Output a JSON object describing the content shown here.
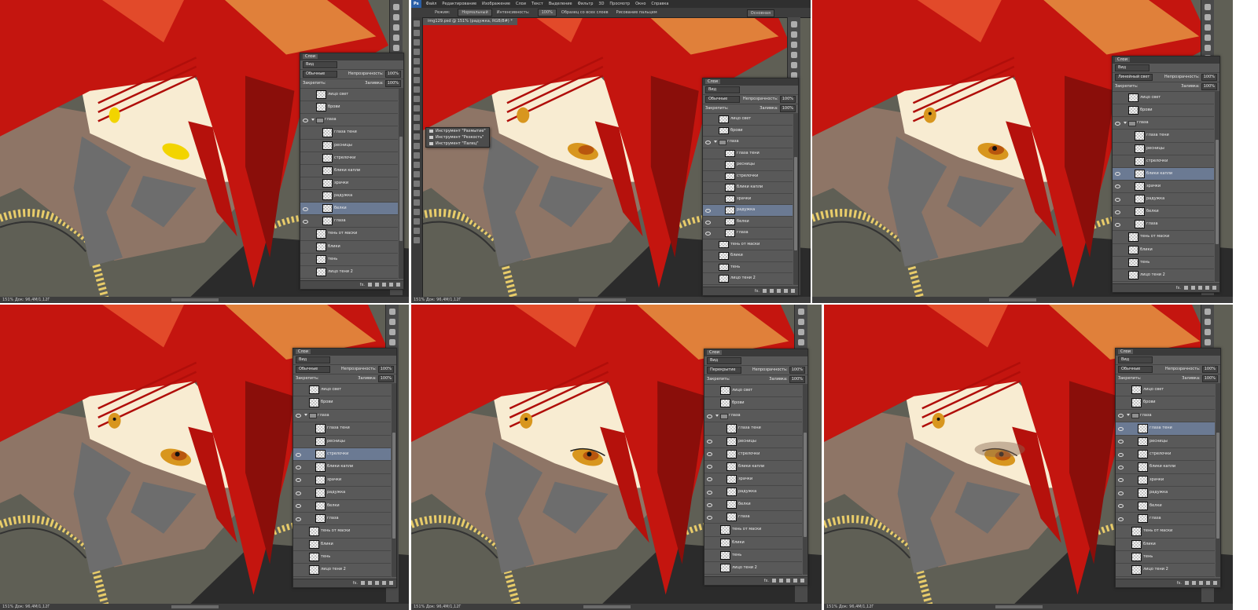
{
  "photoshop": {
    "logo": "Ps",
    "menu": [
      "Файл",
      "Редактирование",
      "Изображение",
      "Слои",
      "Текст",
      "Выделение",
      "Фильтр",
      "3D",
      "Просмотр",
      "Окно",
      "Справка"
    ],
    "options": {
      "mode_label": "Режим:",
      "mode_value": "Нормальный",
      "intensity_label": "Интенсивность:",
      "intensity_value": "100%",
      "sample_all": "Образец со всех слоев",
      "finger": "Рисование пальцем",
      "workspace": "Основная"
    },
    "tab": "img129.psd @ 151% (радужка, RGB/8#) *",
    "tool_flyout": [
      "Инструмент \"Размытие\"",
      "Инструмент \"Резкость\"",
      "Инструмент \"Палец\""
    ]
  },
  "layers_panel": {
    "title": "Слои",
    "filter": "Вид",
    "opacity_label": "Непрозрачность:",
    "opacity_value": "100%",
    "lock_label": "Закрепить:",
    "fill_label": "Заливка:",
    "fill_value": "100%",
    "footer_icon": "fx."
  },
  "panels": [
    {
      "id": "p1",
      "blend": "Обычные",
      "status": "151%  Док: 96,4M/1,12Г",
      "layers": [
        {
          "name": "лицо свет",
          "indent": 0,
          "kind": "layer",
          "visible": false,
          "active": false
        },
        {
          "name": "брови",
          "indent": 0,
          "kind": "layer",
          "visible": false,
          "active": false
        },
        {
          "name": "глаза",
          "indent": 0,
          "kind": "group",
          "visible": true,
          "active": false
        },
        {
          "name": "глаза тени",
          "indent": 1,
          "kind": "layer",
          "visible": false,
          "active": false
        },
        {
          "name": "ресницы",
          "indent": 1,
          "kind": "layer",
          "visible": false,
          "active": false
        },
        {
          "name": "стрелочки",
          "indent": 1,
          "kind": "layer",
          "visible": false,
          "active": false
        },
        {
          "name": "блики капли",
          "indent": 1,
          "kind": "layer",
          "visible": false,
          "active": false
        },
        {
          "name": "зрачки",
          "indent": 1,
          "kind": "layer",
          "visible": false,
          "active": false
        },
        {
          "name": "радужка",
          "indent": 1,
          "kind": "layer",
          "visible": false,
          "active": false
        },
        {
          "name": "белки",
          "indent": 1,
          "kind": "layer",
          "visible": true,
          "active": true
        },
        {
          "name": "глаза",
          "indent": 1,
          "kind": "layer",
          "visible": true,
          "active": false
        },
        {
          "name": "тень от маски",
          "indent": 0,
          "kind": "layer",
          "visible": false,
          "active": false
        },
        {
          "name": "блики",
          "indent": 0,
          "kind": "layer",
          "visible": false,
          "active": false
        },
        {
          "name": "тень",
          "indent": 0,
          "kind": "layer",
          "visible": false,
          "active": false
        },
        {
          "name": "лицо тени 2",
          "indent": 0,
          "kind": "layer",
          "visible": false,
          "active": false
        }
      ]
    },
    {
      "id": "p2",
      "blend": "Обычные",
      "status": "151%  Док: 96,4M/1,12Г",
      "layers": [
        {
          "name": "лицо свет",
          "indent": 0,
          "kind": "layer",
          "visible": false,
          "active": false
        },
        {
          "name": "брови",
          "indent": 0,
          "kind": "layer",
          "visible": false,
          "active": false
        },
        {
          "name": "глаза",
          "indent": 0,
          "kind": "group",
          "visible": true,
          "active": false
        },
        {
          "name": "глаза тени",
          "indent": 1,
          "kind": "layer",
          "visible": false,
          "active": false
        },
        {
          "name": "ресницы",
          "indent": 1,
          "kind": "layer",
          "visible": false,
          "active": false
        },
        {
          "name": "стрелочки",
          "indent": 1,
          "kind": "layer",
          "visible": false,
          "active": false
        },
        {
          "name": "блики капли",
          "indent": 1,
          "kind": "layer",
          "visible": false,
          "active": false
        },
        {
          "name": "зрачки",
          "indent": 1,
          "kind": "layer",
          "visible": false,
          "active": false
        },
        {
          "name": "радужка",
          "indent": 1,
          "kind": "layer",
          "visible": true,
          "active": true
        },
        {
          "name": "белки",
          "indent": 1,
          "kind": "layer",
          "visible": true,
          "active": false
        },
        {
          "name": "глаза",
          "indent": 1,
          "kind": "layer",
          "visible": true,
          "active": false
        },
        {
          "name": "тень от маски",
          "indent": 0,
          "kind": "layer",
          "visible": false,
          "active": false
        },
        {
          "name": "блики",
          "indent": 0,
          "kind": "layer",
          "visible": false,
          "active": false
        },
        {
          "name": "тень",
          "indent": 0,
          "kind": "layer",
          "visible": false,
          "active": false
        },
        {
          "name": "лицо тени 2",
          "indent": 0,
          "kind": "layer",
          "visible": false,
          "active": false
        }
      ]
    },
    {
      "id": "p3",
      "blend": "Линейный свет",
      "status": "",
      "layers": [
        {
          "name": "лицо свет",
          "indent": 0,
          "kind": "layer",
          "visible": false,
          "active": false
        },
        {
          "name": "брови",
          "indent": 0,
          "kind": "layer",
          "visible": false,
          "active": false
        },
        {
          "name": "глаза",
          "indent": 0,
          "kind": "group",
          "visible": true,
          "active": false
        },
        {
          "name": "глаза тени",
          "indent": 1,
          "kind": "layer",
          "visible": false,
          "active": false
        },
        {
          "name": "ресницы",
          "indent": 1,
          "kind": "layer",
          "visible": false,
          "active": false
        },
        {
          "name": "стрелочки",
          "indent": 1,
          "kind": "layer",
          "visible": false,
          "active": false
        },
        {
          "name": "блики капли",
          "indent": 1,
          "kind": "layer",
          "visible": true,
          "active": true
        },
        {
          "name": "зрачки",
          "indent": 1,
          "kind": "layer",
          "visible": true,
          "active": false
        },
        {
          "name": "радужка",
          "indent": 1,
          "kind": "layer",
          "visible": true,
          "active": false
        },
        {
          "name": "белки",
          "indent": 1,
          "kind": "layer",
          "visible": true,
          "active": false
        },
        {
          "name": "глаза",
          "indent": 1,
          "kind": "layer",
          "visible": true,
          "active": false
        },
        {
          "name": "тень от маски",
          "indent": 0,
          "kind": "layer",
          "visible": false,
          "active": false
        },
        {
          "name": "блики",
          "indent": 0,
          "kind": "layer",
          "visible": false,
          "active": false
        },
        {
          "name": "тень",
          "indent": 0,
          "kind": "layer",
          "visible": false,
          "active": false
        },
        {
          "name": "лицо тени 2",
          "indent": 0,
          "kind": "layer",
          "visible": false,
          "active": false
        }
      ]
    },
    {
      "id": "p4",
      "blend": "Обычные",
      "status": "151%  Док: 96,4M/1,12Г",
      "layers": [
        {
          "name": "лицо свет",
          "indent": 0,
          "kind": "layer",
          "visible": false,
          "active": false
        },
        {
          "name": "брови",
          "indent": 0,
          "kind": "layer",
          "visible": false,
          "active": false
        },
        {
          "name": "глаза",
          "indent": 0,
          "kind": "group",
          "visible": true,
          "active": false
        },
        {
          "name": "глаза тени",
          "indent": 1,
          "kind": "layer",
          "visible": false,
          "active": false
        },
        {
          "name": "ресницы",
          "indent": 1,
          "kind": "layer",
          "visible": false,
          "active": false
        },
        {
          "name": "стрелочки",
          "indent": 1,
          "kind": "layer",
          "visible": true,
          "active": true
        },
        {
          "name": "блики капли",
          "indent": 1,
          "kind": "layer",
          "visible": true,
          "active": false
        },
        {
          "name": "зрачки",
          "indent": 1,
          "kind": "layer",
          "visible": true,
          "active": false
        },
        {
          "name": "радужка",
          "indent": 1,
          "kind": "layer",
          "visible": true,
          "active": false
        },
        {
          "name": "белки",
          "indent": 1,
          "kind": "layer",
          "visible": true,
          "active": false
        },
        {
          "name": "глаза",
          "indent": 1,
          "kind": "layer",
          "visible": true,
          "active": false
        },
        {
          "name": "тень от маски",
          "indent": 0,
          "kind": "layer",
          "visible": false,
          "active": false
        },
        {
          "name": "блики",
          "indent": 0,
          "kind": "layer",
          "visible": false,
          "active": false
        },
        {
          "name": "тень",
          "indent": 0,
          "kind": "layer",
          "visible": false,
          "active": false
        },
        {
          "name": "лицо тени 2",
          "indent": 0,
          "kind": "layer",
          "visible": false,
          "active": false
        }
      ]
    },
    {
      "id": "p5",
      "blend": "Перекрытие",
      "status": "151%  Док: 96,4M/1,12Г",
      "layers": [
        {
          "name": "лицо свет",
          "indent": 0,
          "kind": "layer",
          "visible": false,
          "active": false
        },
        {
          "name": "брови",
          "indent": 0,
          "kind": "layer",
          "visible": false,
          "active": false
        },
        {
          "name": "глаза",
          "indent": 0,
          "kind": "group",
          "visible": true,
          "active": false
        },
        {
          "name": "глаза тени",
          "indent": 1,
          "kind": "layer",
          "visible": false,
          "active": false
        },
        {
          "name": "ресницы",
          "indent": 1,
          "kind": "layer",
          "visible": true,
          "active": false
        },
        {
          "name": "стрелочки",
          "indent": 1,
          "kind": "layer",
          "visible": true,
          "active": false
        },
        {
          "name": "блики капли",
          "indent": 1,
          "kind": "layer",
          "visible": true,
          "active": false
        },
        {
          "name": "зрачки",
          "indent": 1,
          "kind": "layer",
          "visible": true,
          "active": false
        },
        {
          "name": "радужка",
          "indent": 1,
          "kind": "layer",
          "visible": true,
          "active": false
        },
        {
          "name": "белки",
          "indent": 1,
          "kind": "layer",
          "visible": true,
          "active": false
        },
        {
          "name": "глаза",
          "indent": 1,
          "kind": "layer",
          "visible": true,
          "active": false
        },
        {
          "name": "тень от маски",
          "indent": 0,
          "kind": "layer",
          "visible": false,
          "active": false
        },
        {
          "name": "блики",
          "indent": 0,
          "kind": "layer",
          "visible": false,
          "active": false
        },
        {
          "name": "тень",
          "indent": 0,
          "kind": "layer",
          "visible": false,
          "active": false
        },
        {
          "name": "лицо тени 2",
          "indent": 0,
          "kind": "layer",
          "visible": false,
          "active": false
        }
      ]
    },
    {
      "id": "p6",
      "blend": "Обычные",
      "status": "151%  Док: 96,4M/1,12Г",
      "layers": [
        {
          "name": "лицо свет",
          "indent": 0,
          "kind": "layer",
          "visible": false,
          "active": false
        },
        {
          "name": "брови",
          "indent": 0,
          "kind": "layer",
          "visible": false,
          "active": false
        },
        {
          "name": "глаза",
          "indent": 0,
          "kind": "group",
          "visible": true,
          "active": false
        },
        {
          "name": "глаза тени",
          "indent": 1,
          "kind": "layer",
          "visible": true,
          "active": true
        },
        {
          "name": "ресницы",
          "indent": 1,
          "kind": "layer",
          "visible": true,
          "active": false
        },
        {
          "name": "стрелочки",
          "indent": 1,
          "kind": "layer",
          "visible": true,
          "active": false
        },
        {
          "name": "блики капли",
          "indent": 1,
          "kind": "layer",
          "visible": true,
          "active": false
        },
        {
          "name": "зрачки",
          "indent": 1,
          "kind": "layer",
          "visible": true,
          "active": false
        },
        {
          "name": "радужка",
          "indent": 1,
          "kind": "layer",
          "visible": true,
          "active": false
        },
        {
          "name": "белки",
          "indent": 1,
          "kind": "layer",
          "visible": true,
          "active": false
        },
        {
          "name": "глаза",
          "indent": 1,
          "kind": "layer",
          "visible": true,
          "active": false
        },
        {
          "name": "тень от маски",
          "indent": 0,
          "kind": "layer",
          "visible": false,
          "active": false
        },
        {
          "name": "блики",
          "indent": 0,
          "kind": "layer",
          "visible": false,
          "active": false
        },
        {
          "name": "тень",
          "indent": 0,
          "kind": "layer",
          "visible": false,
          "active": false
        },
        {
          "name": "лицо тени 2",
          "indent": 0,
          "kind": "layer",
          "visible": false,
          "active": false
        }
      ]
    }
  ],
  "colors": {
    "hair": "#c4150f",
    "hair_light": "#e0803a",
    "skin": "#f8ecd2",
    "mask": "#8e7566",
    "mask_shadow": "#6d6d6d",
    "jacket": "#5f5f55",
    "zipper": "#e8cc6a",
    "iris": "#d8961e",
    "highlight": "#f2d400",
    "ui_dark": "#3d3d3d",
    "ui_panel": "#595959",
    "ui_active": "#6b7a93"
  }
}
